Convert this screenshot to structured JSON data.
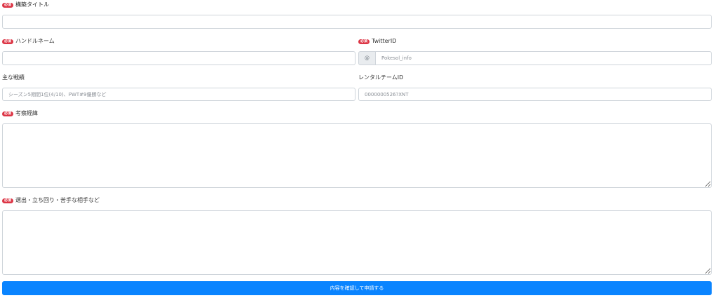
{
  "required_badge": "必須",
  "fields": {
    "build_title": {
      "label": "構築タイトル",
      "value": "",
      "placeholder": ""
    },
    "handle_name": {
      "label": "ハンドルネーム",
      "value": "",
      "placeholder": ""
    },
    "twitter_id": {
      "label": "TwitterID",
      "prefix": "@",
      "value": "",
      "placeholder": "Pokesol_info"
    },
    "main_results": {
      "label": "主な戦績",
      "value": "",
      "placeholder": "シーズン5期間1位(4/10)、PWT#9優勝など"
    },
    "rental_team_id": {
      "label": "レンタルチームID",
      "value": "",
      "placeholder": "0000000526?XNT"
    },
    "consideration": {
      "label": "考察経緯",
      "value": "",
      "placeholder": ""
    },
    "selection": {
      "label": "選出・立ち回り・苦手な相手など",
      "value": "",
      "placeholder": ""
    }
  },
  "submit_label": "内容を確認して申請する",
  "colors": {
    "primary": "#0a84ff",
    "badge": "#dc3545",
    "border": "#ced4da",
    "addon_bg": "#e9ecef"
  }
}
